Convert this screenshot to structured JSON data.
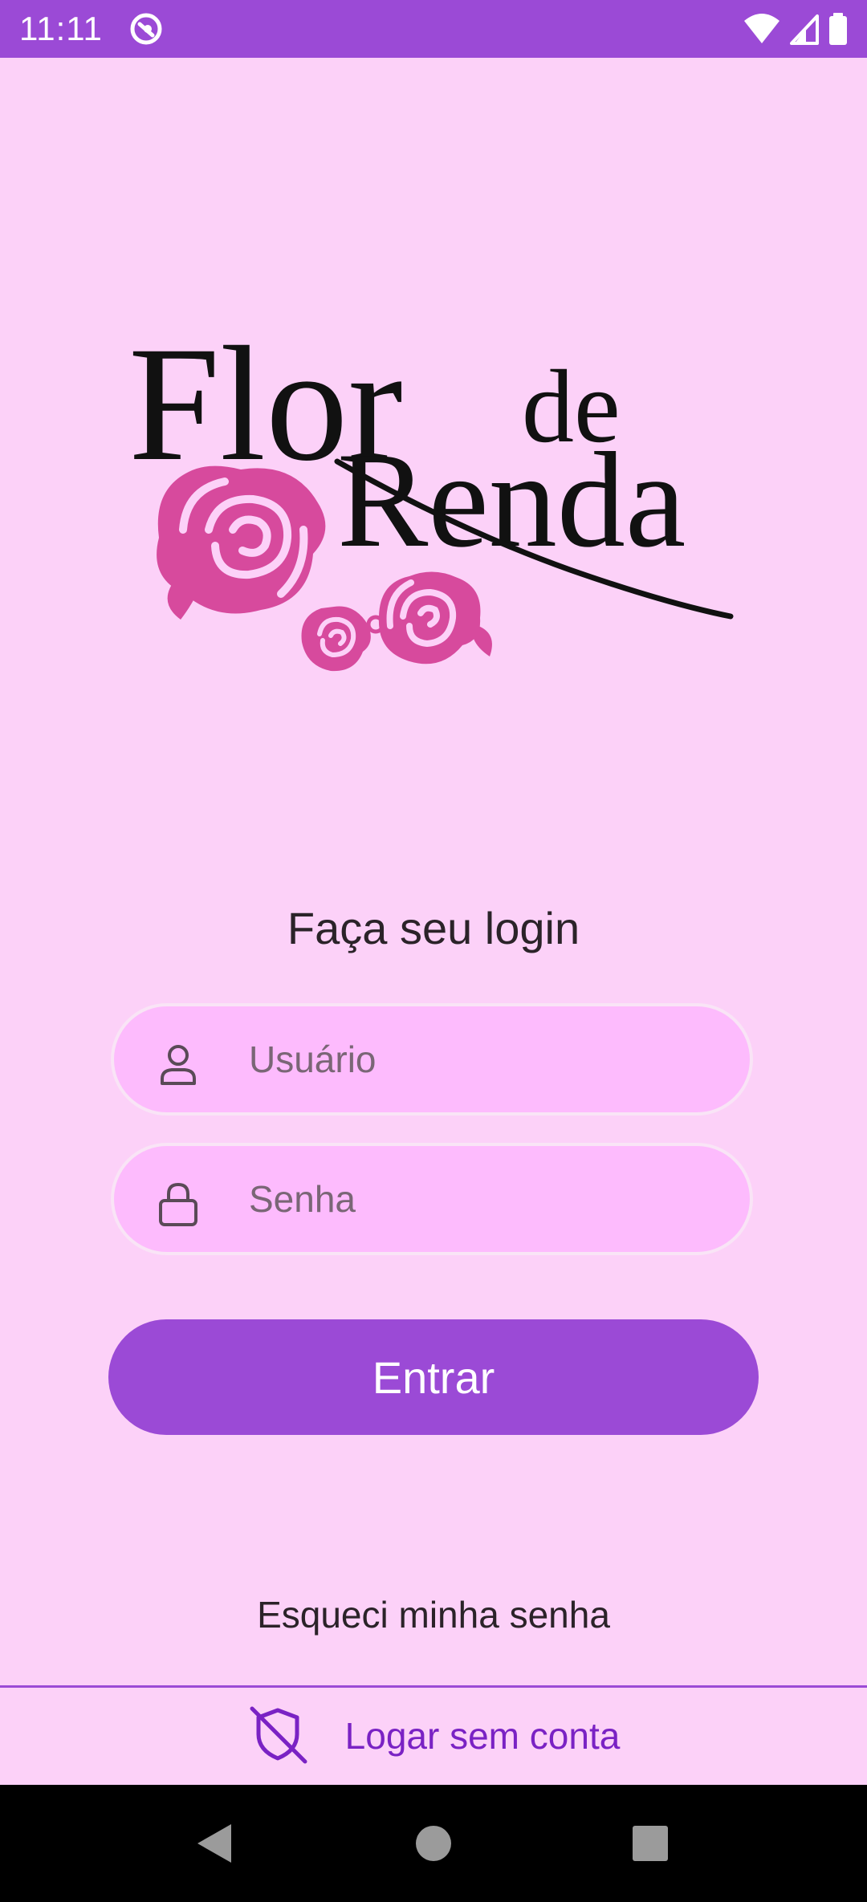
{
  "status_bar": {
    "time": "11:11",
    "icons": [
      "sync-icon",
      "wifi-icon",
      "signal-icon",
      "battery-icon"
    ],
    "background": "#9B4AD6"
  },
  "logo": {
    "line1": "Flor",
    "line2": "de",
    "line3": "Renda",
    "flower_color": "#D74A9D"
  },
  "login": {
    "title": "Faça seu login",
    "username": {
      "placeholder": "Usuário",
      "value": "",
      "icon": "person-icon"
    },
    "password": {
      "placeholder": "Senha",
      "value": "",
      "icon": "lock-icon"
    },
    "submit_label": "Entrar",
    "forgot_label": "Esqueci minha senha"
  },
  "guest": {
    "label": "Logar sem conta",
    "icon": "shield-off-icon"
  },
  "colors": {
    "background": "#FCD1F8",
    "accent": "#9B4AD6",
    "field_bg": "#FDBBFD",
    "guest_text": "#7A22C4"
  },
  "nav_bar": {
    "buttons": [
      "back-icon",
      "home-icon",
      "recents-icon"
    ]
  }
}
